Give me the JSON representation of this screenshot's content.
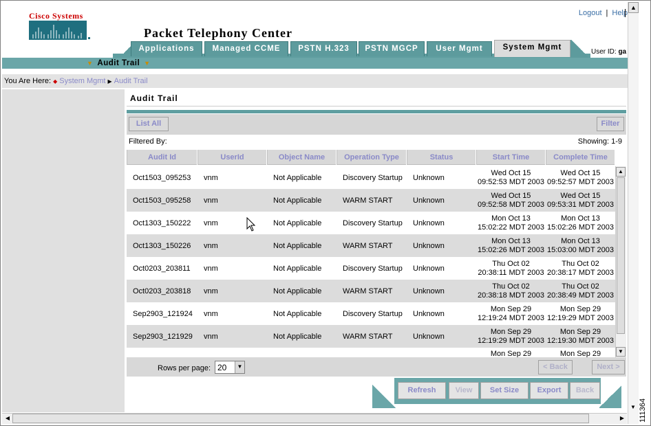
{
  "header": {
    "logo_text": "Cisco Systems",
    "app_title": "Packet Telephony Center",
    "logout": "Logout",
    "help": "Help",
    "userid_label": "User ID:",
    "userid_value": "ga"
  },
  "tabs": [
    {
      "label": "Applications",
      "active": false
    },
    {
      "label": "Managed CCME",
      "active": false
    },
    {
      "label": "PSTN H.323",
      "active": false
    },
    {
      "label": "PSTN MGCP",
      "active": false
    },
    {
      "label": "User Mgmt",
      "active": false
    },
    {
      "label": "System Mgmt",
      "active": true
    }
  ],
  "subnav": {
    "label": "Audit Trail"
  },
  "breadcrumb": {
    "prefix": "You Are Here:",
    "items": [
      "System Mgmt",
      "Audit Trail"
    ]
  },
  "content": {
    "title": "Audit Trail",
    "list_all": "List All",
    "filter": "Filter",
    "filtered_by": "Filtered By:",
    "showing": "Showing: 1-9"
  },
  "table": {
    "columns": [
      "Audit Id",
      "UserId",
      "Object Name",
      "Operation Type",
      "Status",
      "Start Time",
      "Complete Time"
    ],
    "rows": [
      {
        "audit_id": "Oct1503_095253",
        "user": "vnm",
        "object": "Not Applicable",
        "op": "Discovery Startup",
        "status": "Unknown",
        "start_day": "Wed Oct 15",
        "start_time": "09:52:53 MDT 2003",
        "end_day": "Wed Oct 15",
        "end_time": "09:52:57 MDT 2003"
      },
      {
        "audit_id": "Oct1503_095258",
        "user": "vnm",
        "object": "Not Applicable",
        "op": "WARM START",
        "status": "Unknown",
        "start_day": "Wed Oct 15",
        "start_time": "09:52:58 MDT 2003",
        "end_day": "Wed Oct 15",
        "end_time": "09:53:31 MDT 2003"
      },
      {
        "audit_id": "Oct1303_150222",
        "user": "vnm",
        "object": "Not Applicable",
        "op": "Discovery Startup",
        "status": "Unknown",
        "start_day": "Mon Oct 13",
        "start_time": "15:02:22 MDT 2003",
        "end_day": "Mon Oct 13",
        "end_time": "15:02:26 MDT 2003"
      },
      {
        "audit_id": "Oct1303_150226",
        "user": "vnm",
        "object": "Not Applicable",
        "op": "WARM START",
        "status": "Unknown",
        "start_day": "Mon Oct 13",
        "start_time": "15:02:26 MDT 2003",
        "end_day": "Mon Oct 13",
        "end_time": "15:03:00 MDT 2003"
      },
      {
        "audit_id": "Oct0203_203811",
        "user": "vnm",
        "object": "Not Applicable",
        "op": "Discovery Startup",
        "status": "Unknown",
        "start_day": "Thu Oct 02",
        "start_time": "20:38:11 MDT 2003",
        "end_day": "Thu Oct 02",
        "end_time": "20:38:17 MDT 2003"
      },
      {
        "audit_id": "Oct0203_203818",
        "user": "vnm",
        "object": "Not Applicable",
        "op": "WARM START",
        "status": "Unknown",
        "start_day": "Thu Oct 02",
        "start_time": "20:38:18 MDT 2003",
        "end_day": "Thu Oct 02",
        "end_time": "20:38:49 MDT 2003"
      },
      {
        "audit_id": "Sep2903_121924",
        "user": "vnm",
        "object": "Not Applicable",
        "op": "Discovery Startup",
        "status": "Unknown",
        "start_day": "Mon Sep 29",
        "start_time": "12:19:24 MDT 2003",
        "end_day": "Mon Sep 29",
        "end_time": "12:19:29 MDT 2003"
      },
      {
        "audit_id": "Sep2903_121929",
        "user": "vnm",
        "object": "Not Applicable",
        "op": "WARM START",
        "status": "Unknown",
        "start_day": "Mon Sep 29",
        "start_time": "12:19:29 MDT 2003",
        "end_day": "Mon Sep 29",
        "end_time": "12:19:30 MDT 2003"
      },
      {
        "audit_id": "",
        "user": "",
        "object": "",
        "op": "",
        "status": "",
        "start_day": "Mon Sep 29",
        "start_time": "",
        "end_day": "Mon Sep 29",
        "end_time": ""
      }
    ]
  },
  "pagination": {
    "rows_per_page_label": "Rows per page:",
    "rows_per_page_value": "20",
    "back": "< Back",
    "next": "Next >"
  },
  "actions": {
    "refresh": "Refresh",
    "view": "View",
    "set_size": "Set Size",
    "export": "Export",
    "back": "Back"
  },
  "figure_id": "111364",
  "colors": {
    "teal": "#5f9ea0",
    "tab": "#5d9b9d",
    "link": "#3a6ea5",
    "button_text": "#8a8ac8",
    "logo_red": "#cc0000"
  }
}
